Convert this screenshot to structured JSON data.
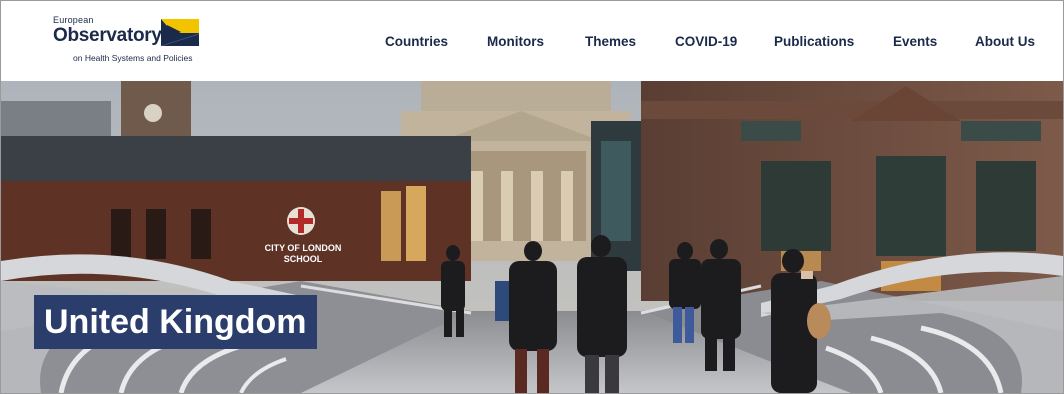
{
  "logo": {
    "top_text": "European",
    "main_text": "Observatory",
    "sub_text": "on Health Systems and Policies"
  },
  "nav": {
    "items": [
      {
        "label": "Countries"
      },
      {
        "label": "Monitors"
      },
      {
        "label": "Themes"
      },
      {
        "label": "COVID-19"
      },
      {
        "label": "Publications"
      },
      {
        "label": "Events"
      },
      {
        "label": "About Us"
      }
    ]
  },
  "hero": {
    "title": "United Kingdom",
    "building_sign_line1": "CITY OF LONDON",
    "building_sign_line2": "SCHOOL"
  },
  "colors": {
    "brand_navy": "#1b2a4a",
    "title_banner": "#2b3d6b",
    "flag_yellow": "#f2c400"
  }
}
